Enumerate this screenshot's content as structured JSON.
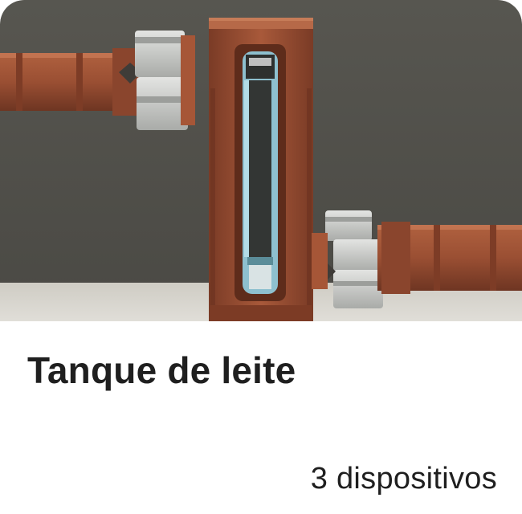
{
  "card": {
    "title": "Tanque de leite",
    "device_count": "3 dispositivos",
    "thumbnail": {
      "icon": "milk-tank-preview-image",
      "colors": {
        "wall": "#4f4e49",
        "floor": "#d9d7d0",
        "copper": "#9a4f33",
        "copper_dark": "#6e3522",
        "glass": "#8ec0cf",
        "metal": "#c7c9c6"
      }
    }
  }
}
